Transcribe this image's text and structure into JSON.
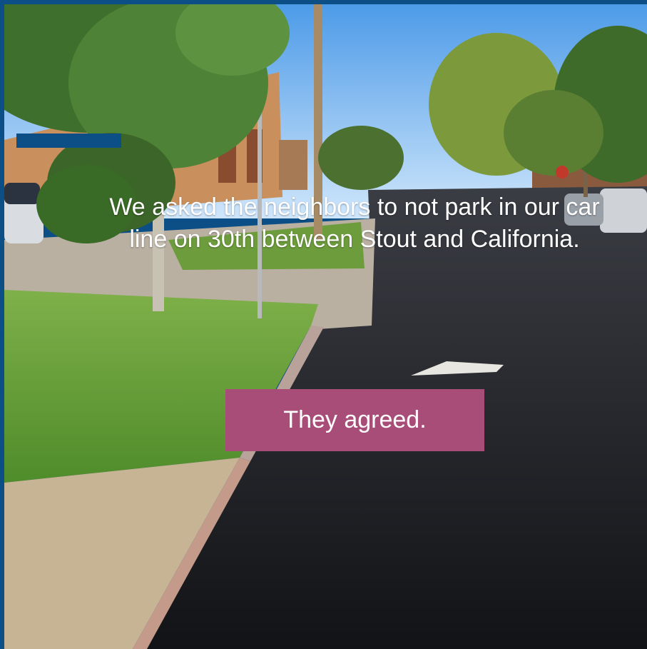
{
  "colors": {
    "frame": "#0b4f86",
    "accent_bar": "#0b4f86",
    "callout_bg": "#a84d78",
    "text": "#ffffff"
  },
  "slide": {
    "photo": "street-sidewalk-photo",
    "caption": "We asked the neighbors to not park in our car line on 30th between Stout and California.",
    "callout": "They agreed."
  }
}
